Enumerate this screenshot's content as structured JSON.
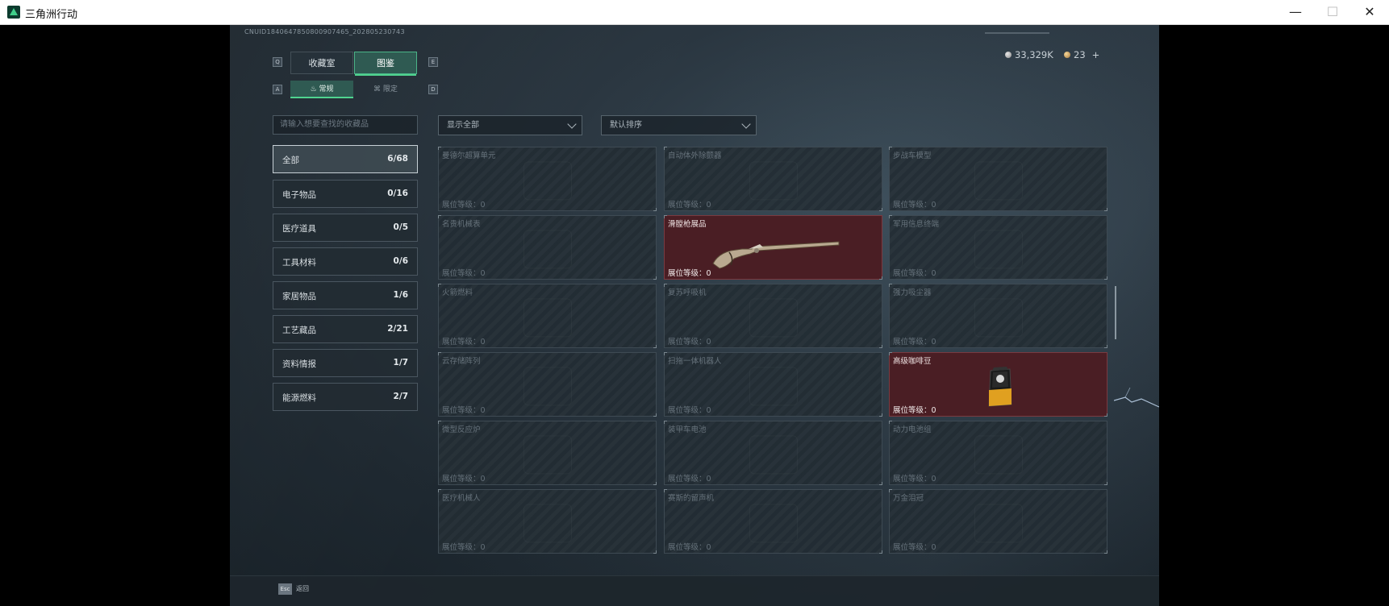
{
  "window": {
    "title": "三角洲行动",
    "minimize": "—",
    "maximize": "☐",
    "close": "✕"
  },
  "header": {
    "uid": "CNUID1840647850800907465_202805230743",
    "currency_1": "33,329K",
    "currency_2": "23",
    "plus": "+"
  },
  "tabs": [
    {
      "label": "收藏室",
      "active": false
    },
    {
      "label": "图鉴",
      "active": true
    }
  ],
  "tab_keys": {
    "left": "Q",
    "right": "E"
  },
  "subtabs": [
    {
      "label": "常规",
      "active": true
    },
    {
      "label": "限定",
      "active": false
    }
  ],
  "subtab_keys": {
    "left": "A",
    "right": "D"
  },
  "search": {
    "placeholder": "请输入想要查找的收藏品"
  },
  "filters": {
    "show": "显示全部",
    "sort": "默认排序"
  },
  "categories": [
    {
      "name": "全部",
      "count": "6/68",
      "active": true
    },
    {
      "name": "电子物品",
      "count": "0/16"
    },
    {
      "name": "医疗道具",
      "count": "0/5"
    },
    {
      "name": "工具材料",
      "count": "0/6"
    },
    {
      "name": "家居物品",
      "count": "1/6"
    },
    {
      "name": "工艺藏品",
      "count": "2/21"
    },
    {
      "name": "资料情报",
      "count": "1/7"
    },
    {
      "name": "能源燃料",
      "count": "2/7"
    }
  ],
  "items": [
    {
      "name": "曼德尔超算单元",
      "level": "展位等级：0",
      "owned": false
    },
    {
      "name": "自动体外除颤器",
      "level": "展位等级：0",
      "owned": false
    },
    {
      "name": "步战车模型",
      "level": "展位等级：0",
      "owned": false
    },
    {
      "name": "名贵机械表",
      "level": "展位等级：0",
      "owned": false
    },
    {
      "name": "滑膛枪展品",
      "level": "展位等级：0",
      "owned": true
    },
    {
      "name": "军用信息终端",
      "level": "展位等级：0",
      "owned": false
    },
    {
      "name": "火箭燃料",
      "level": "展位等级：0",
      "owned": false
    },
    {
      "name": "复苏呼吸机",
      "level": "展位等级：0",
      "owned": false
    },
    {
      "name": "强力吸尘器",
      "level": "展位等级：0",
      "owned": false
    },
    {
      "name": "云存储阵列",
      "level": "展位等级：0",
      "owned": false
    },
    {
      "name": "扫拖一体机器人",
      "level": "展位等级：0",
      "owned": false
    },
    {
      "name": "高级咖啡豆",
      "level": "展位等级：0",
      "owned": true
    },
    {
      "name": "微型反应炉",
      "level": "展位等级：0",
      "owned": false
    },
    {
      "name": "装甲车电池",
      "level": "展位等级：0",
      "owned": false
    },
    {
      "name": "动力电池组",
      "level": "展位等级：0",
      "owned": false
    },
    {
      "name": "医疗机械人",
      "level": "展位等级：0",
      "owned": false
    },
    {
      "name": "赛斯的留声机",
      "level": "展位等级：0",
      "owned": false
    },
    {
      "name": "万金泪冠",
      "level": "展位等级：0",
      "owned": false
    }
  ],
  "footer": {
    "esc_key": "Esc",
    "esc_label": "返回"
  },
  "colors": {
    "accent": "#4fd48f",
    "owned_bg": "#4a1e24"
  }
}
